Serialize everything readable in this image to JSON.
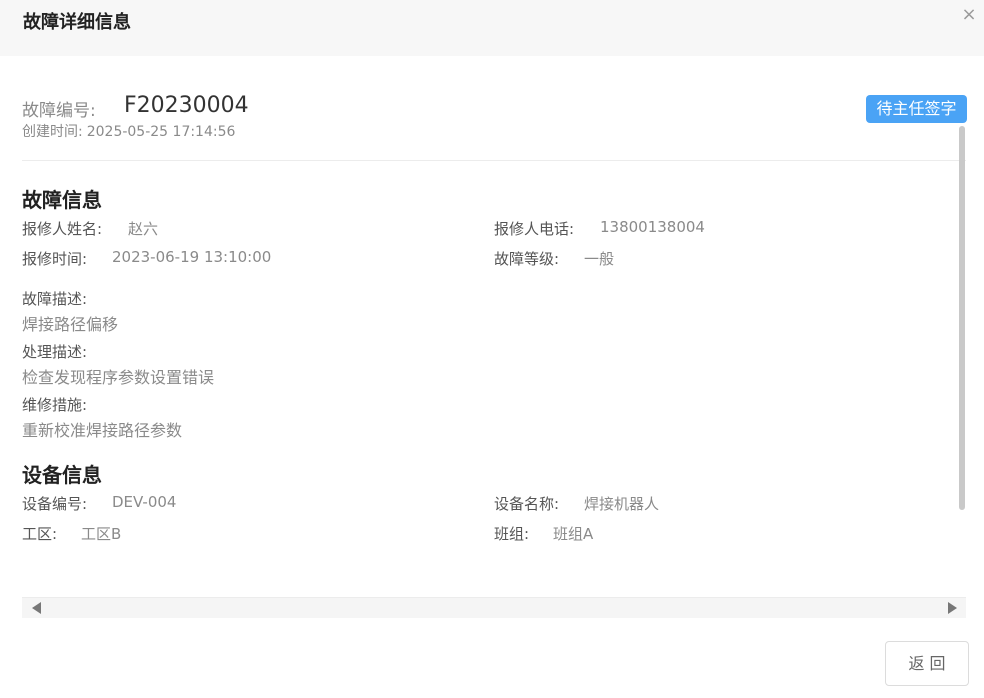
{
  "dialog": {
    "title": "故障详细信息",
    "close_symbol": "×"
  },
  "summary": {
    "fault_no_label": "故障编号:",
    "fault_no": "F20230004",
    "created_label": "创建时间:",
    "created_value": "2025-05-25 17:14:56",
    "status": "待主任签字",
    "status_color": "#4aa3f5"
  },
  "fault_section": {
    "title": "故障信息",
    "reporter_name_label": "报修人姓名:",
    "reporter_name": "赵六",
    "reporter_phone_label": "报修人电话:",
    "reporter_phone": "13800138004",
    "report_time_label": "报修时间:",
    "report_time": "2023-06-19 13:10:00",
    "level_label": "故障等级:",
    "level": "一般",
    "description_label": "故障描述:",
    "description": "焊接路径偏移",
    "handling_label": "处理描述:",
    "handling": "检查发现程序参数设置错误",
    "measures_label": "维修措施:",
    "measures": "重新校准焊接路径参数"
  },
  "device_section": {
    "title": "设备信息",
    "device_no_label": "设备编号:",
    "device_no": "DEV-004",
    "device_name_label": "设备名称:",
    "device_name": "焊接机器人",
    "zone_label": "工区:",
    "zone": "工区B",
    "team_label": "班组:",
    "team": "班组A"
  },
  "footer": {
    "back_label": "返 回"
  }
}
